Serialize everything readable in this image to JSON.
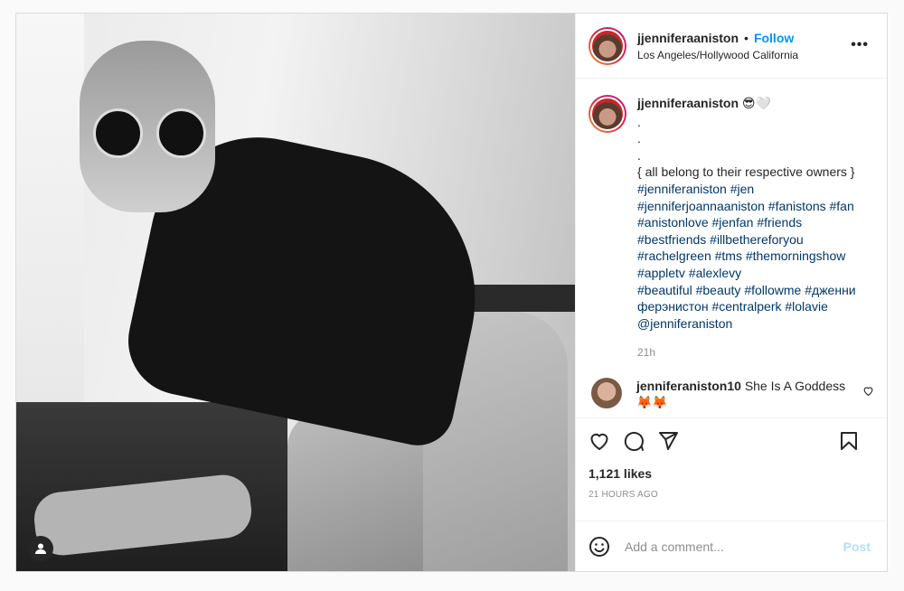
{
  "header": {
    "username": "jjenniferaaniston",
    "separator": "•",
    "follow_label": "Follow",
    "location": "Los Angeles/Hollywood California",
    "more_label": "•••"
  },
  "caption": {
    "username": "jjenniferaaniston",
    "emoji": "😎🤍",
    "dots": [
      ".",
      ".",
      "."
    ],
    "text": "{ all belong to their respective owners }",
    "hashtag_lines": [
      "#jenniferaniston #jen",
      "#jenniferjoannaaniston #fanistons #fan",
      "#anistonlove #jenfan #friends",
      "#bestfriends #illbethereforyou",
      "#rachelgreen #tms #themorningshow",
      "#appletv #alexlevy",
      "#beautiful #beauty #followme #дженни",
      "ферэнистон #centralperk #lolavie",
      "@jenniferaniston"
    ],
    "time": "21h"
  },
  "comment": {
    "username": "jenniferaniston10",
    "text": "She Is A Goddess",
    "emoji": "🦊🦊"
  },
  "stats": {
    "likes": "1,121 likes",
    "ago": "21 HOURS AGO"
  },
  "add_comment": {
    "placeholder": "Add a comment...",
    "post_label": "Post"
  },
  "icons": [
    "user-tag-icon",
    "more-icon",
    "heart-icon",
    "comment-icon",
    "share-icon",
    "bookmark-icon",
    "emoji-icon"
  ],
  "colors": {
    "accent": "#0095f6",
    "tag": "#00376b",
    "muted": "#8e8e8e",
    "post_disabled": "#b2dffc"
  }
}
